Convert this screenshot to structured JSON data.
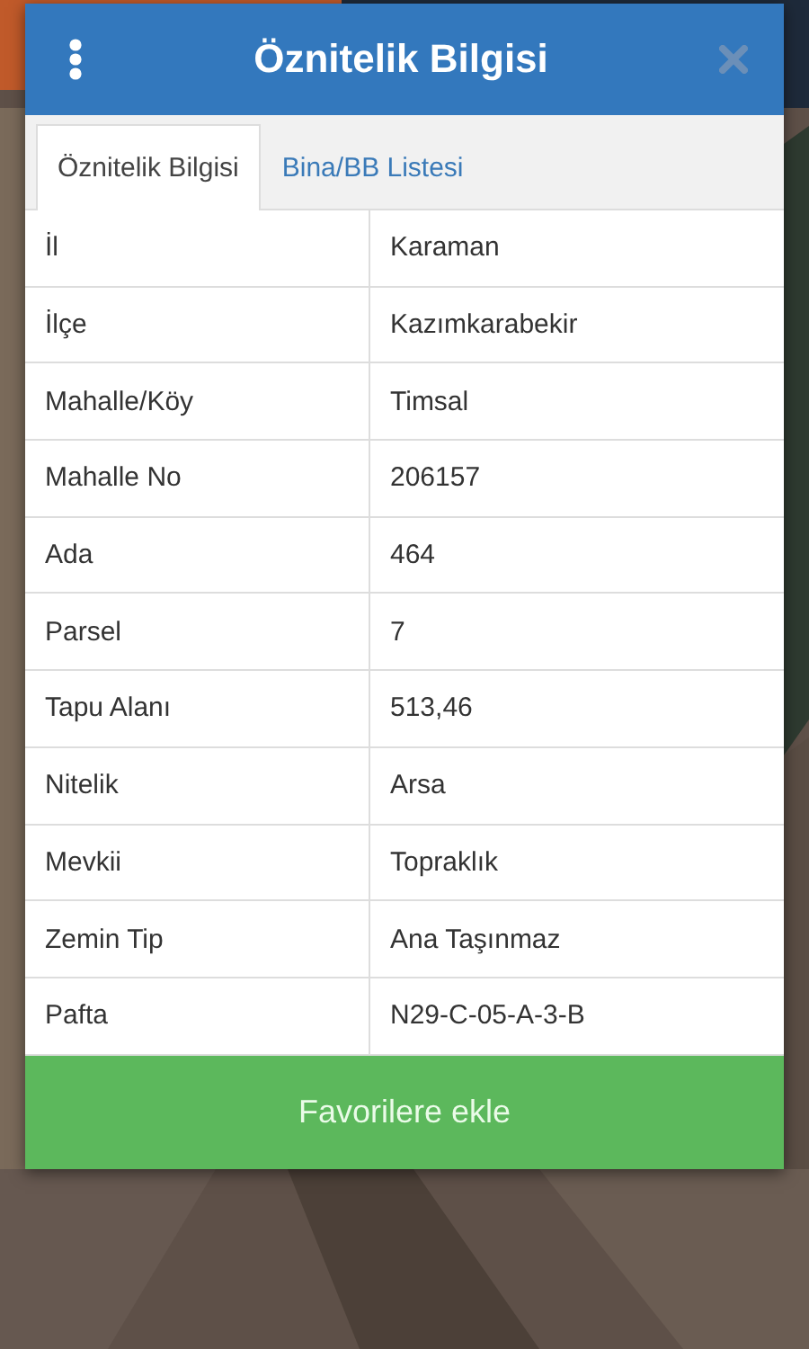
{
  "dialog": {
    "title": "Öznitelik Bilgisi"
  },
  "tabs": [
    {
      "label": "Öznitelik Bilgisi",
      "selected": true
    },
    {
      "label": "Bina/BB Listesi",
      "selected": false
    }
  ],
  "attributes": [
    {
      "name": "İl",
      "value": "Karaman"
    },
    {
      "name": "İlçe",
      "value": "Kazımkarabekir"
    },
    {
      "name": "Mahalle/Köy",
      "value": "Timsal"
    },
    {
      "name": "Mahalle No",
      "value": "206157"
    },
    {
      "name": "Ada",
      "value": "464"
    },
    {
      "name": "Parsel",
      "value": "7"
    },
    {
      "name": "Tapu Alanı",
      "value": "513,46"
    },
    {
      "name": "Nitelik",
      "value": "Arsa"
    },
    {
      "name": "Mevkii",
      "value": "Topraklık"
    },
    {
      "name": "Zemin Tip",
      "value": "Ana Taşınmaz"
    },
    {
      "name": "Pafta",
      "value": "N29-C-05-A-3-B"
    }
  ],
  "action_button": "Favorilere ekle"
}
